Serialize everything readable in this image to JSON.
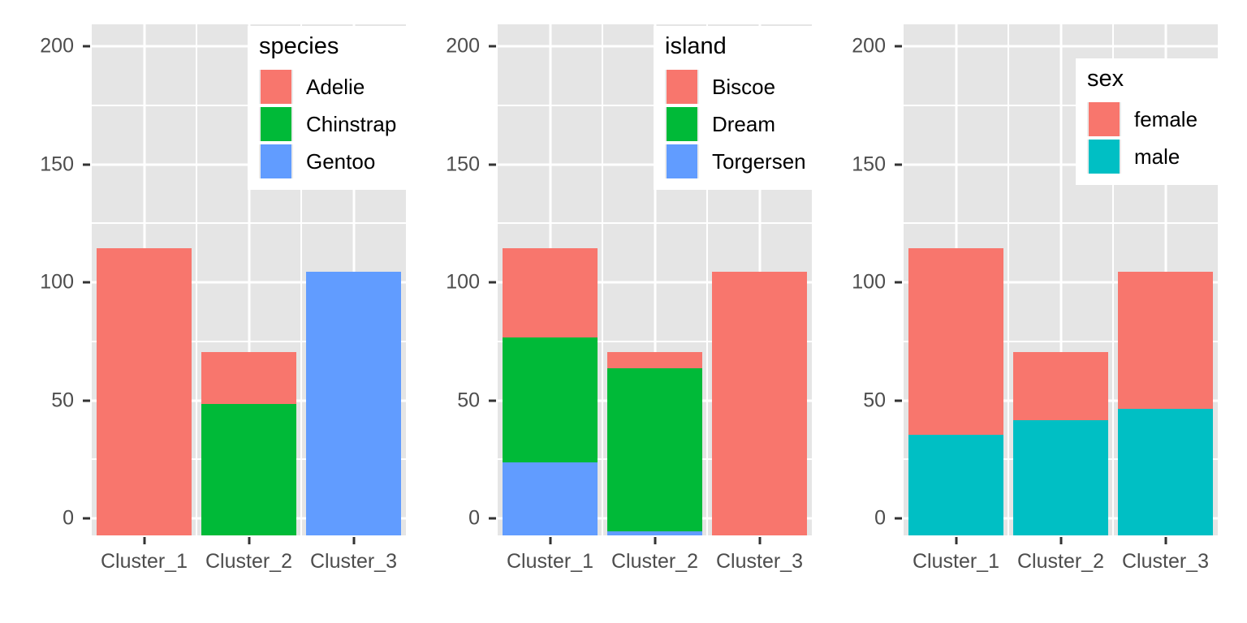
{
  "chart_data": [
    {
      "type": "bar",
      "subtype": "stacked",
      "panel": "species",
      "title": "",
      "xlabel": "",
      "ylabel": "",
      "categories": [
        "Cluster_1",
        "Cluster_2",
        "Cluster_3"
      ],
      "ylim": [
        0,
        210
      ],
      "yticks": [
        0,
        50,
        100,
        150,
        200
      ],
      "ytick_labels": [
        "0",
        "50",
        "100",
        "150",
        "200"
      ],
      "grid": true,
      "legend": {
        "title": "species",
        "position": "inside-top-right",
        "entries": [
          {
            "label": "Adelie",
            "color": "#f8766d"
          },
          {
            "label": "Chinstrap",
            "color": "#00ba38"
          },
          {
            "label": "Gentoo",
            "color": "#619cff"
          }
        ]
      },
      "series": [
        {
          "name": "Chinstrap",
          "color": "#00ba38",
          "values": [
            5,
            63,
            0
          ]
        },
        {
          "name": "Adelie",
          "color": "#f8766d",
          "values": [
            124,
            22,
            0
          ]
        },
        {
          "name": "Gentoo",
          "color": "#619cff",
          "values": [
            0,
            0,
            119
          ]
        }
      ],
      "totals": [
        129,
        85,
        119
      ]
    },
    {
      "type": "bar",
      "subtype": "stacked",
      "panel": "island",
      "title": "",
      "xlabel": "",
      "ylabel": "",
      "categories": [
        "Cluster_1",
        "Cluster_2",
        "Cluster_3"
      ],
      "ylim": [
        0,
        210
      ],
      "yticks": [
        0,
        50,
        100,
        150,
        200
      ],
      "ytick_labels": [
        "0",
        "50",
        "100",
        "150",
        "200"
      ],
      "grid": true,
      "legend": {
        "title": "island",
        "position": "inside-top-right",
        "entries": [
          {
            "label": "Biscoe",
            "color": "#f8766d"
          },
          {
            "label": "Dream",
            "color": "#00ba38"
          },
          {
            "label": "Torgersen",
            "color": "#619cff"
          }
        ]
      },
      "series": [
        {
          "name": "Torgersen",
          "color": "#619cff",
          "values": [
            38,
            9,
            0
          ]
        },
        {
          "name": "Dream",
          "color": "#00ba38",
          "values": [
            53,
            69,
            0
          ]
        },
        {
          "name": "Biscoe",
          "color": "#f8766d",
          "values": [
            38,
            7,
            119
          ]
        }
      ],
      "totals": [
        129,
        85,
        119
      ]
    },
    {
      "type": "bar",
      "subtype": "stacked",
      "panel": "sex",
      "title": "",
      "xlabel": "",
      "ylabel": "",
      "categories": [
        "Cluster_1",
        "Cluster_2",
        "Cluster_3"
      ],
      "ylim": [
        0,
        210
      ],
      "yticks": [
        0,
        50,
        100,
        150,
        200
      ],
      "ytick_labels": [
        "0",
        "50",
        "100",
        "150",
        "200"
      ],
      "grid": true,
      "legend": {
        "title": "sex",
        "position": "inside-top-right",
        "entries": [
          {
            "label": "female",
            "color": "#f8766d"
          },
          {
            "label": "male",
            "color": "#00bfc4"
          }
        ]
      },
      "series": [
        {
          "name": "male",
          "color": "#00bfc4",
          "values": [
            50,
            56,
            61
          ]
        },
        {
          "name": "female",
          "color": "#f8766d",
          "values": [
            79,
            29,
            58
          ]
        }
      ],
      "totals": [
        129,
        85,
        119
      ]
    }
  ],
  "panels": [
    {
      "name": "species-panel",
      "legend_title": "species",
      "legend_items": [
        {
          "label": "Adelie",
          "color": "#f8766d"
        },
        {
          "label": "Chinstrap",
          "color": "#00ba38"
        },
        {
          "label": "Gentoo",
          "color": "#619cff"
        }
      ],
      "y_labels": [
        "200",
        "150",
        "100",
        "50",
        "0"
      ],
      "x_labels": [
        "Cluster_1",
        "Cluster_2",
        "Cluster_3"
      ]
    },
    {
      "name": "island-panel",
      "legend_title": "island",
      "legend_items": [
        {
          "label": "Biscoe",
          "color": "#f8766d"
        },
        {
          "label": "Dream",
          "color": "#00ba38"
        },
        {
          "label": "Torgersen",
          "color": "#619cff"
        }
      ],
      "y_labels": [
        "200",
        "150",
        "100",
        "50",
        "0"
      ],
      "x_labels": [
        "Cluster_1",
        "Cluster_2",
        "Cluster_3"
      ]
    },
    {
      "name": "sex-panel",
      "legend_title": "sex",
      "legend_items": [
        {
          "label": "female",
          "color": "#f8766d"
        },
        {
          "label": "male",
          "color": "#00bfc4"
        }
      ],
      "y_labels": [
        "200",
        "150",
        "100",
        "50",
        "0"
      ],
      "x_labels": [
        "Cluster_1",
        "Cluster_2",
        "Cluster_3"
      ]
    }
  ],
  "theme": {
    "panel_background": "#e5e5e5",
    "grid_color": "#ffffff",
    "figure_background": "#ffffff",
    "axis_text_color": "#4d4d4d",
    "legend_background": "#ffffff",
    "legend_key_background": "#ebebeb"
  }
}
